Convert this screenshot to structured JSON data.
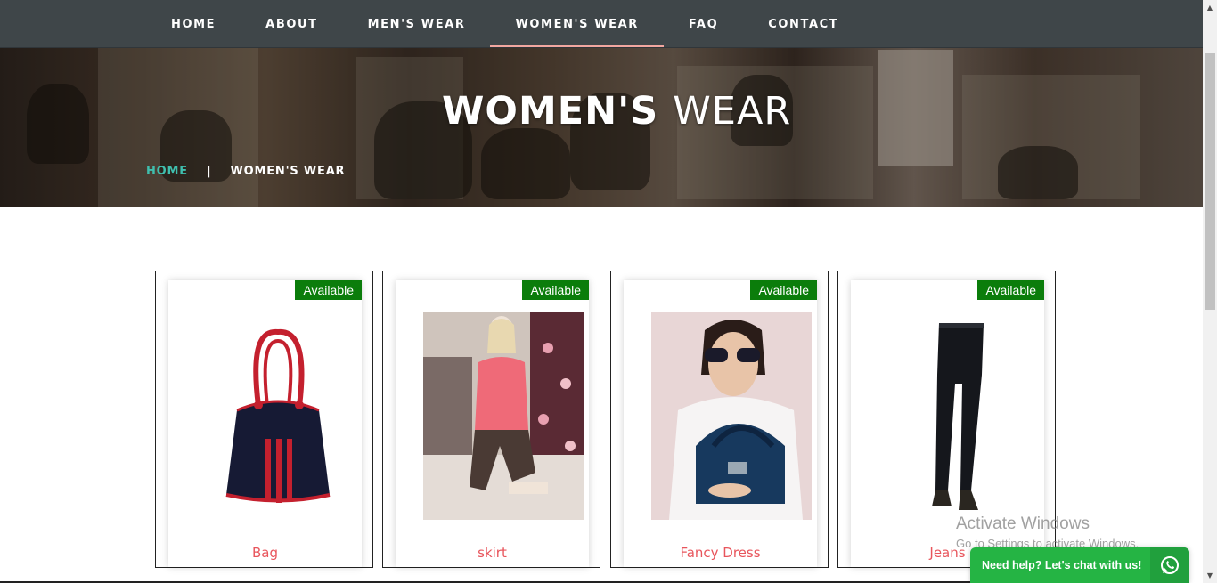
{
  "nav": {
    "items": [
      {
        "label": "HOME"
      },
      {
        "label": "ABOUT"
      },
      {
        "label": "MEN'S WEAR"
      },
      {
        "label": "WOMEN'S WEAR"
      },
      {
        "label": "FAQ"
      },
      {
        "label": "CONTACT"
      }
    ],
    "active_item": "WOMEN'S WEAR",
    "active_color": "#f2a7a0"
  },
  "hero": {
    "title_bold": "WOMEN'S",
    "title_light": "WEAR",
    "breadcrumb": {
      "home": "HOME",
      "separator": "|",
      "current": "WOMEN'S WEAR"
    }
  },
  "products": [
    {
      "badge": "Available",
      "name": "Bag",
      "image_icon": "handbag-image"
    },
    {
      "badge": "Available",
      "name": "skirt",
      "image_icon": "mannequin-image"
    },
    {
      "badge": "Available",
      "name": "Fancy Dress",
      "image_icon": "woman-with-purse-image"
    },
    {
      "badge": "Available",
      "name": "Jeans",
      "image_icon": "jeans-image"
    }
  ],
  "colors": {
    "nav_bg": "#3f4649",
    "badge_bg": "#0b7d0b",
    "product_name": "#e8555c",
    "breadcrumb_home": "#3fbfae",
    "chat_bg": "#25b444"
  },
  "watermark": {
    "line1": "Activate Windows",
    "line2": "Go to Settings to activate Windows."
  },
  "chat": {
    "label": "Need help? Let's chat with us!",
    "icon": "whatsapp-icon"
  }
}
